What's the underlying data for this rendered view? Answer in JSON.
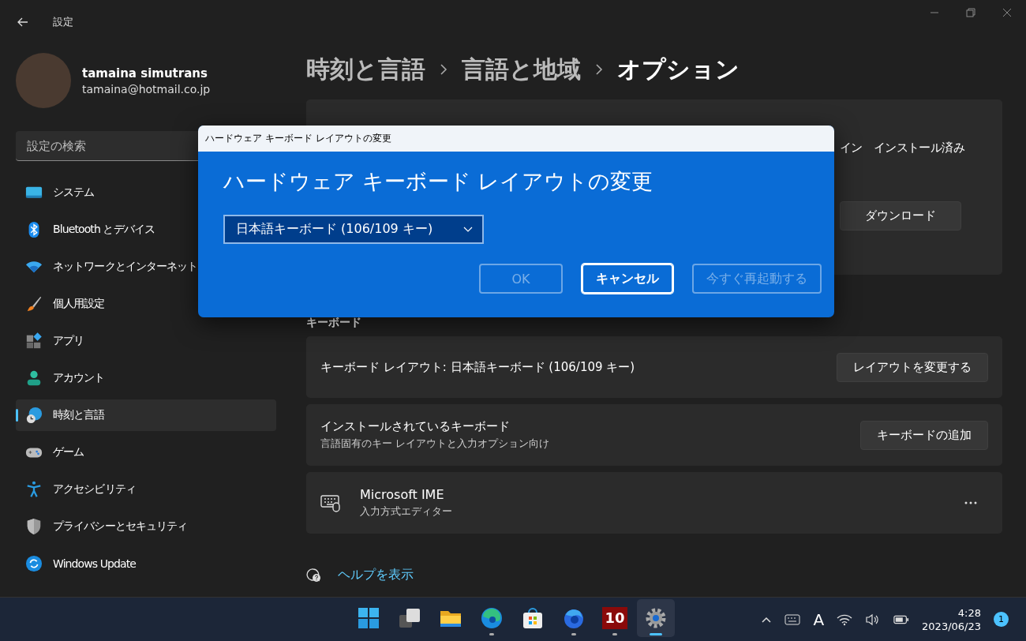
{
  "window": {
    "title": "設定"
  },
  "account": {
    "name": "tamaina simutrans",
    "email": "tamaina@hotmail.co.jp"
  },
  "search": {
    "placeholder": "設定の検索"
  },
  "nav": [
    {
      "label": "システム",
      "kind": "system",
      "selected": false
    },
    {
      "label": "Bluetooth とデバイス",
      "kind": "bluetooth",
      "selected": false
    },
    {
      "label": "ネットワークとインターネット",
      "kind": "network",
      "selected": false
    },
    {
      "label": "個人用設定",
      "kind": "brush",
      "selected": false
    },
    {
      "label": "アプリ",
      "kind": "apps",
      "selected": false
    },
    {
      "label": "アカウント",
      "kind": "account",
      "selected": false
    },
    {
      "label": "時刻と言語",
      "kind": "time",
      "selected": true
    },
    {
      "label": "ゲーム",
      "kind": "game",
      "selected": false
    },
    {
      "label": "アクセシビリティ",
      "kind": "access",
      "selected": false
    },
    {
      "label": "プライバシーとセキュリティ",
      "kind": "shield",
      "selected": false
    },
    {
      "label": "Windows Update",
      "kind": "update",
      "selected": false
    }
  ],
  "breadcrumb": [
    "時刻と言語",
    "言語と地域",
    "オプション"
  ],
  "top_card": {
    "texts": [
      "イン",
      "インストール済み"
    ],
    "button": "ダウンロード"
  },
  "section_heading": "キーボード",
  "layout_card": {
    "label": "キーボード レイアウト: 日本語キーボード (106/109 キー)",
    "button": "レイアウトを変更する"
  },
  "installed_card": {
    "title": "インストールされているキーボード",
    "subtitle": "言語固有のキー レイアウトと入力オプション向け",
    "button": "キーボードの追加"
  },
  "ime_card": {
    "title": "Microsoft IME",
    "subtitle": "入力方式エディター"
  },
  "help_link": "ヘルプを表示",
  "dialog": {
    "caption": "ハードウェア キーボード レイアウトの変更",
    "heading": "ハードウェア キーボード レイアウトの変更",
    "dropdown": {
      "value": "日本語キーボード (106/109 キー)"
    },
    "buttons": [
      {
        "label": "OK",
        "disabled": true,
        "focused": false
      },
      {
        "label": "キャンセル",
        "disabled": false,
        "focused": true
      },
      {
        "label": "今すぐ再起動する",
        "disabled": true,
        "focused": false
      }
    ]
  },
  "taskbar": {
    "apps": [
      {
        "kind": "start",
        "running": false,
        "selected": false
      },
      {
        "kind": "taskview",
        "running": false,
        "selected": false
      },
      {
        "kind": "explorer",
        "running": false,
        "selected": false
      },
      {
        "kind": "edge",
        "running": true,
        "selected": false
      },
      {
        "kind": "store",
        "running": false,
        "selected": false
      },
      {
        "kind": "firefox",
        "running": true,
        "selected": false
      },
      {
        "kind": "tile",
        "label": "10",
        "running": true,
        "selected": false
      },
      {
        "kind": "settings",
        "running": true,
        "selected": true
      }
    ],
    "ime_indicator": "A",
    "time": "4:28",
    "date": "2023/06/23",
    "notification_count": "1"
  }
}
